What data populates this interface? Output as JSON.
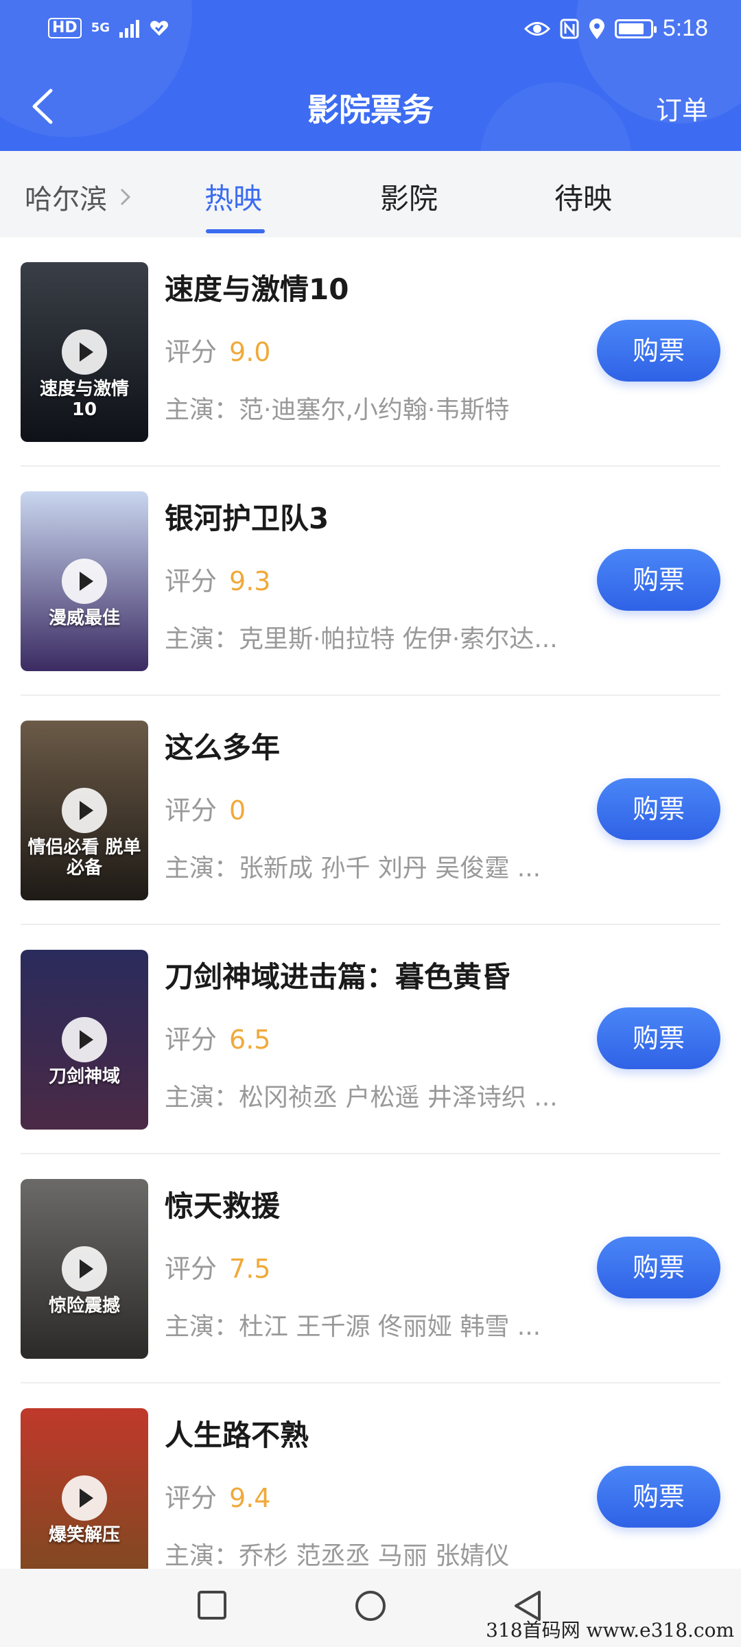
{
  "status_bar": {
    "hd": "HD",
    "network": "5G",
    "time": "5:18",
    "battery_level": 0.85
  },
  "nav": {
    "title": "影院票务",
    "orders": "订单"
  },
  "tabs": {
    "city": "哈尔滨",
    "items": [
      {
        "label": "热映",
        "active": true
      },
      {
        "label": "影院",
        "active": false
      },
      {
        "label": "待映",
        "active": false
      }
    ]
  },
  "labels": {
    "score": "评分",
    "buy": "购票"
  },
  "movies": [
    {
      "title": "速度与激情10",
      "score": "9.0",
      "cast": "主演：范·迪塞尔,小约翰·韦斯特",
      "poster_text": "速度与激情10",
      "poster_colors": [
        "#3a3f47",
        "#0e1117"
      ]
    },
    {
      "title": "银河护卫队3",
      "score": "9.3",
      "cast": "主演：克里斯·帕拉特 佐伊·索尔达...",
      "poster_text": "漫威最佳",
      "poster_colors": [
        "#c9d6ef",
        "#3b2b62"
      ]
    },
    {
      "title": "这么多年",
      "score": "0",
      "cast": "主演：张新成 孙千 刘丹 吴俊霆 ...",
      "poster_text": "情侣必看 脱单必备",
      "poster_colors": [
        "#6b5a47",
        "#1e1a16"
      ]
    },
    {
      "title": "刀剑神域进击篇：暮色黄昏",
      "score": "6.5",
      "cast": "主演：松冈祯丞 户松遥 井泽诗织 ...",
      "poster_text": "刀剑神域",
      "poster_colors": [
        "#2a2b5c",
        "#4b2a45"
      ]
    },
    {
      "title": "惊天救援",
      "score": "7.5",
      "cast": "主演：杜江 王千源 佟丽娅 韩雪 ...",
      "poster_text": "惊险震撼",
      "poster_colors": [
        "#6b6a68",
        "#2c2a28"
      ]
    },
    {
      "title": "人生路不熟",
      "score": "9.4",
      "cast": "主演：乔杉 范丞丞 马丽 张婧仪",
      "poster_text": "爆笑解压",
      "poster_colors": [
        "#c0392b",
        "#7a4a20"
      ]
    }
  ],
  "watermark": "318首码网 www.e318.com"
}
